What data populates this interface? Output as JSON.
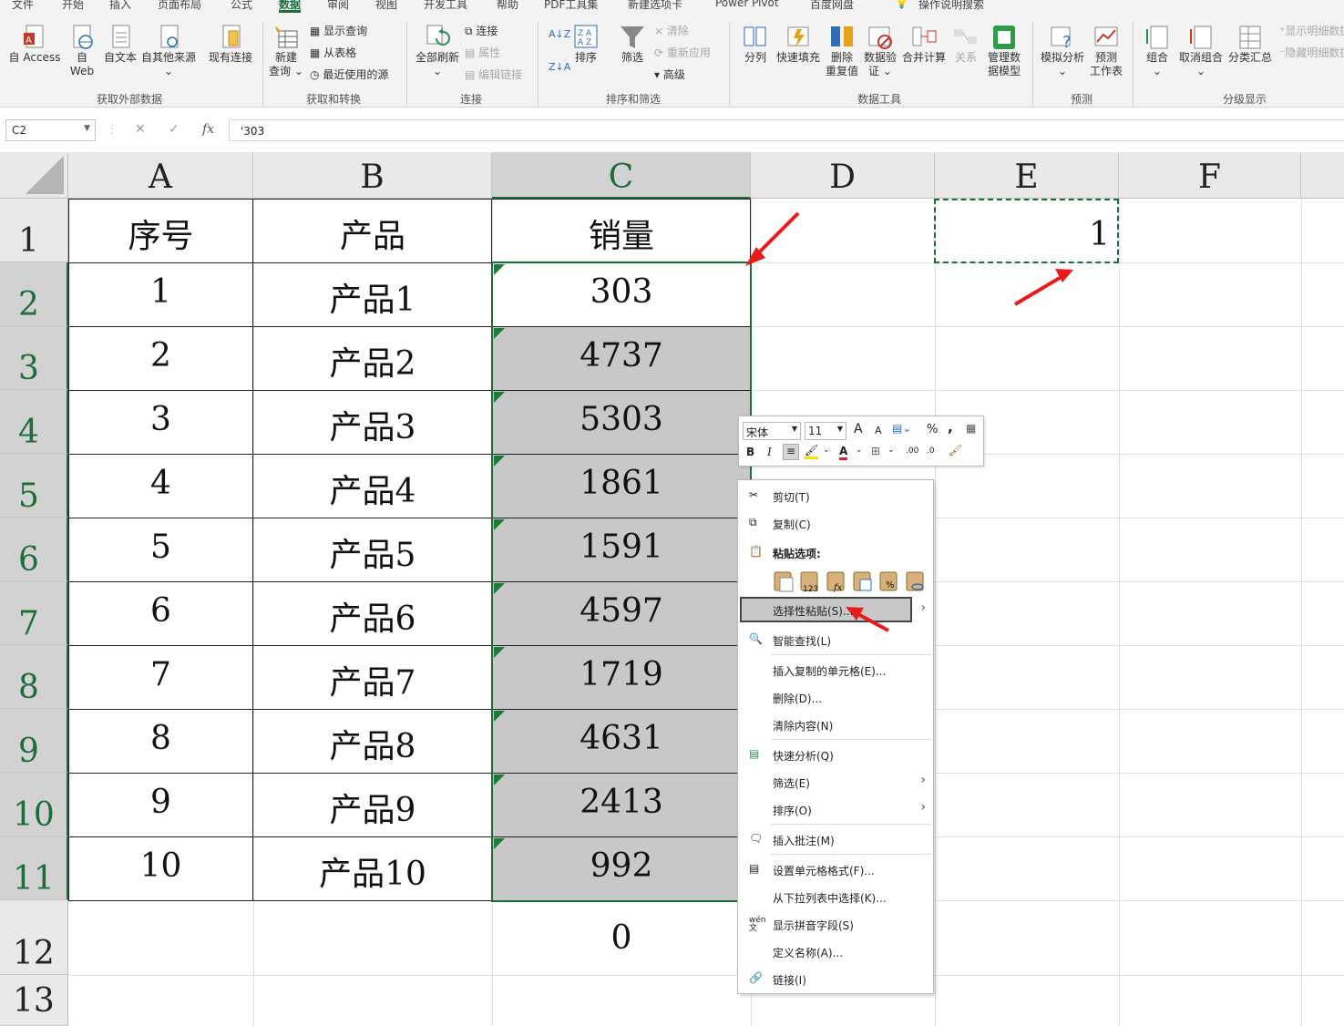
{
  "ribbon": {
    "tabs": [
      "文件",
      "开始",
      "插入",
      "页面布局",
      "公式",
      "数据",
      "审阅",
      "视图",
      "开发工具",
      "帮助",
      "PDF工具集",
      "新建选项卡",
      "Power Pivot",
      "百度网盘",
      "操作说明搜索"
    ],
    "active_tab": "数据",
    "groups": {
      "get_external": {
        "label": "获取外部数据",
        "from_access": "自 Access",
        "from_web_1": "自",
        "from_web_2": "Web",
        "from_text": "自文本",
        "from_other": "自其他来源",
        "existing_conn": "现有连接"
      },
      "get_transform": {
        "label": "获取和转换",
        "new_query_1": "新建",
        "new_query_2": "查询",
        "show_queries": "显示查询",
        "from_table": "从表格",
        "recent_sources": "最近使用的源"
      },
      "connections": {
        "label": "连接",
        "refresh_all": "全部刷新",
        "connections": "连接",
        "properties": "属性",
        "edit_links": "编辑链接"
      },
      "sort_filter": {
        "label": "排序和筛选",
        "sort": "排序",
        "filter": "筛选",
        "clear": "清除",
        "reapply": "重新应用",
        "advanced": "高级"
      },
      "data_tools": {
        "label": "数据工具",
        "text_to_cols": "分列",
        "flash_fill": "快速填充",
        "remove_dup_1": "删除",
        "remove_dup_2": "重复值",
        "validation_1": "数据验",
        "validation_2": "证",
        "consolidate": "合并计算",
        "relations": "关系",
        "data_model_1": "管理数",
        "data_model_2": "据模型"
      },
      "forecast": {
        "label": "预测",
        "what_if": "模拟分析",
        "forecast_sheet_1": "预测",
        "forecast_sheet_2": "工作表"
      },
      "outline": {
        "label": "分级显示",
        "group": "组合",
        "ungroup": "取消组合",
        "subtotal": "分类汇总",
        "show_detail": "显示明细数据",
        "hide_detail": "隐藏明细数据"
      }
    }
  },
  "formula_bar": {
    "name_box": "C2",
    "formula": "'303",
    "fx": "fx"
  },
  "sheet": {
    "columns": [
      "A",
      "B",
      "C",
      "D",
      "E",
      "F"
    ],
    "rows": [
      "1",
      "2",
      "3",
      "4",
      "5",
      "6",
      "7",
      "8",
      "9",
      "10",
      "11",
      "12",
      "13"
    ],
    "header": [
      "序号",
      "产品",
      "销量"
    ],
    "table": [
      [
        "1",
        "产品1",
        "303"
      ],
      [
        "2",
        "产品2",
        "4737"
      ],
      [
        "3",
        "产品3",
        "5303"
      ],
      [
        "4",
        "产品4",
        "1861"
      ],
      [
        "5",
        "产品5",
        "1591"
      ],
      [
        "6",
        "产品6",
        "4597"
      ],
      [
        "7",
        "产品7",
        "1719"
      ],
      [
        "8",
        "产品8",
        "4631"
      ],
      [
        "9",
        "产品9",
        "2413"
      ],
      [
        "10",
        "产品10",
        "992"
      ]
    ],
    "c12": "0",
    "e1": "1"
  },
  "mini_toolbar": {
    "font_name": "宋体",
    "font_size": "11",
    "grow_font": "A",
    "shrink_font": "A",
    "percent": "%",
    "comma": ",",
    "bold": "B",
    "italic": "I",
    "font_color_letter": "A",
    "inc_decimal": ".00",
    "dec_decimal": ".0"
  },
  "context_menu": {
    "cut": "剪切(T)",
    "copy": "复制(C)",
    "paste_options": "粘贴选项:",
    "paste_special": "选择性粘贴(S)...",
    "smart_lookup": "智能查找(L)",
    "insert_copied": "插入复制的单元格(E)...",
    "delete": "删除(D)...",
    "clear_contents": "清除内容(N)",
    "quick_analysis": "快速分析(Q)",
    "filter": "筛选(E)",
    "sort": "排序(O)",
    "insert_comment": "插入批注(M)",
    "format_cells": "设置单元格格式(F)...",
    "pick_from_list": "从下拉列表中选择(K)...",
    "phonetic": "显示拼音字段(S)",
    "define_name": "定义名称(A)...",
    "link": "链接(I)",
    "paste_values_badge": "123",
    "paste_formula_badge": "fx",
    "paste_format_badge": "%"
  }
}
